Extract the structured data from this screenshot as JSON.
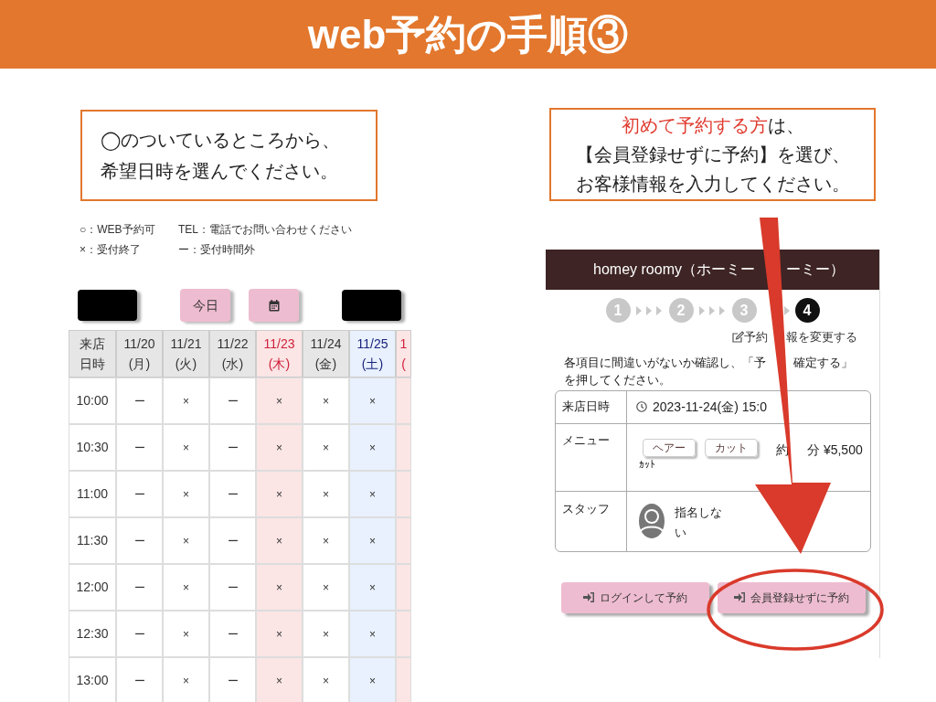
{
  "slide_title": "web予約の手順③",
  "left": {
    "callout": [
      "◯のついているところから、",
      "希望日時を選んでください。"
    ],
    "legend": [
      "○：WEB予約可",
      "TEL：電話でお問い合わせください",
      "×：受付終了",
      "ー：受付時間外"
    ],
    "today_button": "今日",
    "table": {
      "corner": [
        "来店",
        "日時"
      ],
      "columns": [
        {
          "date": "11/20",
          "day": "(月)",
          "kind": "weekday"
        },
        {
          "date": "11/21",
          "day": "(火)",
          "kind": "weekday"
        },
        {
          "date": "11/22",
          "day": "(水)",
          "kind": "weekday"
        },
        {
          "date": "11/23",
          "day": "(木)",
          "kind": "holiday"
        },
        {
          "date": "11/24",
          "day": "(金)",
          "kind": "weekday"
        },
        {
          "date": "11/25",
          "day": "(土)",
          "kind": "saturday"
        },
        {
          "date": "1",
          "day": "(",
          "kind": "holiday"
        }
      ],
      "rows": [
        {
          "time": "10:00",
          "cells": [
            "ー",
            "×",
            "ー",
            "×",
            "×",
            "×"
          ]
        },
        {
          "time": "10:30",
          "cells": [
            "ー",
            "×",
            "ー",
            "×",
            "×",
            "×"
          ]
        },
        {
          "time": "11:00",
          "cells": [
            "ー",
            "×",
            "ー",
            "×",
            "×",
            "×"
          ]
        },
        {
          "time": "11:30",
          "cells": [
            "ー",
            "×",
            "ー",
            "×",
            "×",
            "×"
          ]
        },
        {
          "time": "12:00",
          "cells": [
            "ー",
            "×",
            "ー",
            "×",
            "×",
            "×"
          ]
        },
        {
          "time": "12:30",
          "cells": [
            "ー",
            "×",
            "ー",
            "×",
            "×",
            "×"
          ]
        },
        {
          "time": "13:00",
          "cells": [
            "ー",
            "×",
            "ー",
            "×",
            "×",
            "×"
          ]
        }
      ]
    }
  },
  "right": {
    "callout": {
      "highlight": "初めて予約する方",
      "rest": "は、",
      "lines": [
        "【会員登録せずに予約】を選び、",
        "お客様情報を入力してください。"
      ]
    },
    "shop_title": [
      "homey roomy（ホーミー",
      "ーミー）"
    ],
    "steps": [
      {
        "label": "1",
        "selected": false
      },
      {
        "label": "2",
        "selected": false
      },
      {
        "label": "3",
        "selected": false
      },
      {
        "label": "4",
        "selected": true
      }
    ],
    "edit_link": [
      "予約",
      "報を変更する"
    ],
    "instruction": [
      "各項目に間違いがないか確認し、「予",
      "確定する」",
      "を押してください。"
    ],
    "details": {
      "date_label": "来店日時",
      "date_value": "2023-11-24(金) 15:0",
      "menu_label": "メニュー",
      "menu_tags": [
        "ヘアー",
        "カット"
      ],
      "menu_name": "ｶｯﾄ",
      "duration": "約",
      "price": "分 ¥5,500",
      "staff_label": "スタッフ",
      "staff_value": "指名しない"
    },
    "buttons": [
      {
        "label": "ログインして予約",
        "circled": false
      },
      {
        "label": "会員登録せずに予約",
        "circled": true
      }
    ]
  }
}
